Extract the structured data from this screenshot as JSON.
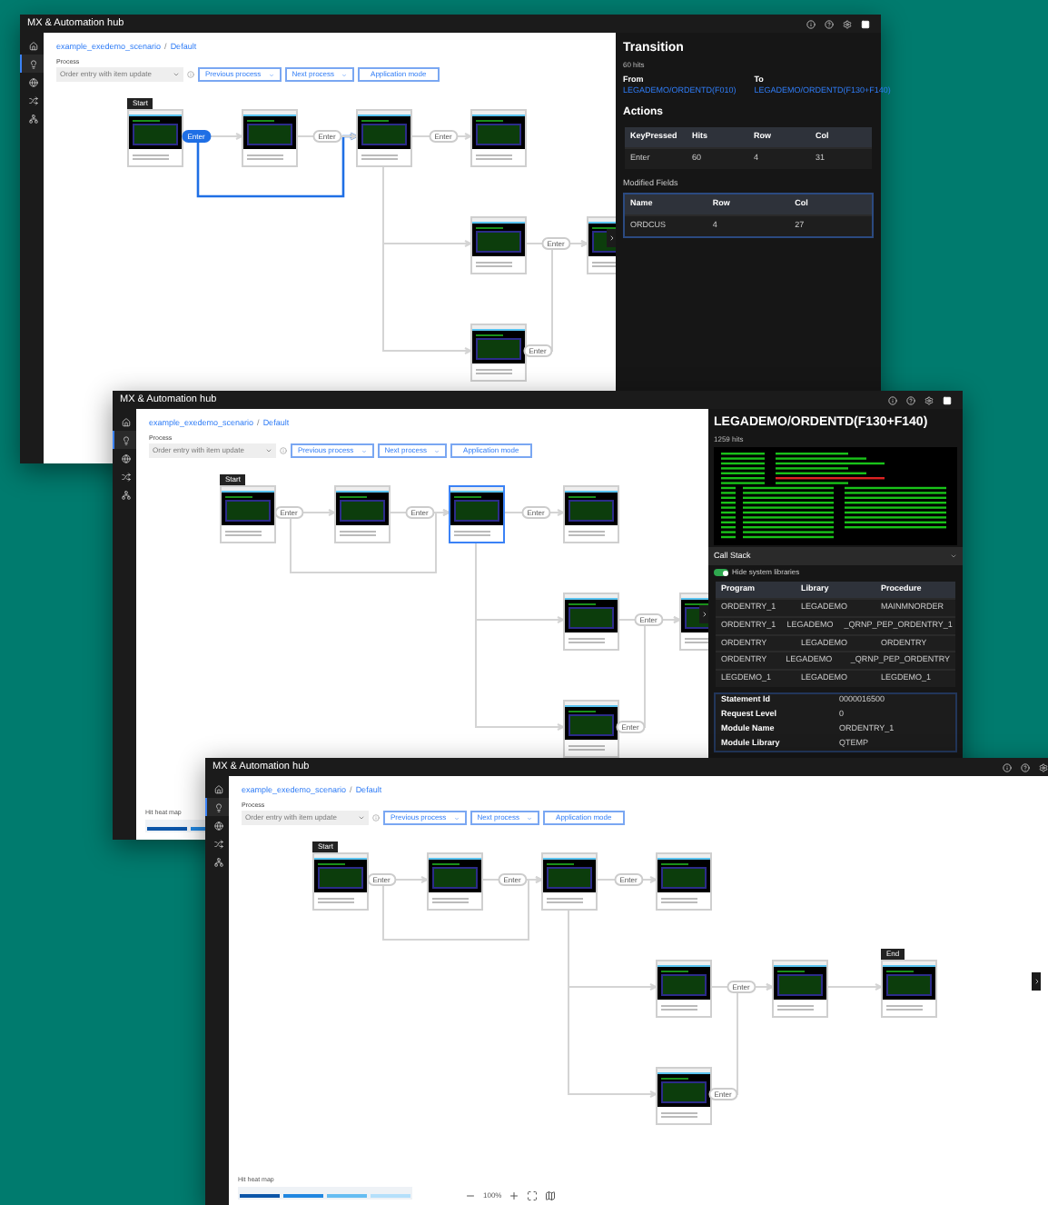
{
  "windows": [
    {
      "title": "MX & Automation hub",
      "breadcrumb": {
        "scenario": "example_exedemo_scenario",
        "separator": "/",
        "view": "Default"
      },
      "process_label": "Process",
      "process_select": "Order entry with item update",
      "buttons": [
        {
          "label": "Previous process",
          "kind": "dropdown"
        },
        {
          "label": "Next process",
          "kind": "dropdown"
        },
        {
          "label": "Application mode",
          "kind": "plain"
        }
      ],
      "sidebar": [
        {
          "selected": false
        },
        {
          "selected": true
        },
        {
          "selected": false
        },
        {
          "selected": false
        },
        {
          "selected": false
        }
      ],
      "diagram": {
        "nodes": [
          {
            "badge": "Start",
            "selected": false
          },
          {
            "selected": false
          },
          {
            "selected": false
          },
          {
            "selected": false
          },
          {
            "selected": false
          },
          {
            "selected": false
          },
          {
            "selected": false
          }
        ],
        "edges": [
          {
            "selected": false
          },
          {
            "label": "Enter",
            "selected": true
          },
          {
            "label": "Enter",
            "selected": false
          },
          {
            "label": "Enter",
            "selected": false
          },
          {
            "selected": false
          },
          {
            "selected": false
          },
          {
            "label": "Enter",
            "selected": false
          },
          {
            "label": "Enter",
            "selected": false
          }
        ]
      },
      "panel": {
        "kind": "transition",
        "title": "Transition",
        "subtitle": "60 hits",
        "from_label": "From",
        "from": "LEGADEMO/ORDENTD(F010)",
        "to_label": "To",
        "to": "LEGADEMO/ORDENTD(F130+F140)",
        "actions_title": "Actions",
        "actions": {
          "columns": [
            "KeyPressed",
            "Hits",
            "Row",
            "Col"
          ],
          "rows": [
            [
              "Enter",
              "60",
              "4",
              "31"
            ]
          ]
        },
        "fields_title": "Modified Fields",
        "fields": {
          "columns": [
            "Name",
            "Row",
            "Col"
          ],
          "rows": [
            [
              "ORDCUS",
              "4",
              "27"
            ]
          ]
        }
      }
    },
    {
      "title": "MX & Automation hub",
      "breadcrumb": {
        "scenario": "example_exedemo_scenario",
        "separator": "/",
        "view": "Default"
      },
      "process_label": "Process",
      "process_select": "Order entry with item update",
      "buttons": [
        {
          "label": "Previous process",
          "kind": "dropdown"
        },
        {
          "label": "Next process",
          "kind": "dropdown"
        },
        {
          "label": "Application mode",
          "kind": "plain"
        }
      ],
      "sidebar": [
        {
          "selected": false
        },
        {
          "selected": true
        },
        {
          "selected": false
        },
        {
          "selected": false
        },
        {
          "selected": false
        }
      ],
      "diagram": {
        "nodes": [
          {
            "badge": "Start",
            "selected": false
          },
          {
            "selected": false
          },
          {
            "selected": true
          },
          {
            "selected": false
          },
          {
            "selected": false
          },
          {
            "selected": false
          },
          {
            "selected": false
          }
        ],
        "edges": [
          {
            "selected": false
          },
          {
            "label": "Enter",
            "selected": false
          },
          {
            "label": "Enter",
            "selected": false
          },
          {
            "label": "Enter",
            "selected": false
          },
          {
            "selected": false
          },
          {
            "selected": false
          },
          {
            "label": "Enter",
            "selected": false
          },
          {
            "label": "Enter",
            "selected": false
          }
        ]
      },
      "heatmap": {
        "label": "Hit heat map"
      },
      "panel": {
        "kind": "screen",
        "title": "LEGADEMO/ORDENTD(F130+F140)",
        "subtitle": "1259 hits",
        "call_stack": {
          "title": "Call Stack",
          "toggle": {
            "label": "Hide system libraries",
            "on": true
          },
          "columns": [
            "Program",
            "Library",
            "Procedure"
          ],
          "rows": [
            [
              "ORDENTRY_1",
              "LEGADEMO",
              "MAINMNORDER"
            ],
            [
              "ORDENTRY_1",
              "LEGADEMO",
              "_QRNP_PEP_ORDENTRY_1"
            ],
            [
              "ORDENTRY",
              "LEGADEMO",
              "ORDENTRY"
            ],
            [
              "ORDENTRY",
              "LEGADEMO",
              "_QRNP_PEP_ORDENTRY"
            ],
            [
              "LEGDEMO_1",
              "LEGADEMO",
              "LEGDEMO_1"
            ]
          ]
        },
        "details": [
          {
            "label": "Statement Id",
            "value": "0000016500"
          },
          {
            "label": "Request Level",
            "value": "0"
          },
          {
            "label": "Module Name",
            "value": "ORDENTRY_1"
          },
          {
            "label": "Module Library",
            "value": "QTEMP"
          }
        ]
      }
    },
    {
      "title": "MX & Automation hub",
      "breadcrumb": {
        "scenario": "example_exedemo_scenario",
        "separator": "/",
        "view": "Default"
      },
      "process_label": "Process",
      "process_select": "Order entry with item update",
      "buttons": [
        {
          "label": "Previous process",
          "kind": "dropdown"
        },
        {
          "label": "Next process",
          "kind": "dropdown"
        },
        {
          "label": "Application mode",
          "kind": "plain"
        }
      ],
      "sidebar": [
        {
          "selected": false
        },
        {
          "selected": true
        },
        {
          "selected": false
        },
        {
          "selected": false
        },
        {
          "selected": false
        }
      ],
      "diagram": {
        "nodes": [
          {
            "badge": "Start",
            "selected": false
          },
          {
            "selected": false
          },
          {
            "selected": false
          },
          {
            "selected": false
          },
          {
            "selected": false
          },
          {
            "selected": false
          },
          {
            "selected": false
          },
          {
            "badge": "End",
            "selected": false
          }
        ],
        "edges": [
          {
            "selected": false
          },
          {
            "label": "Enter",
            "selected": false
          },
          {
            "label": "Enter",
            "selected": false
          },
          {
            "label": "Enter",
            "selected": false
          },
          {
            "selected": false
          },
          {
            "selected": false
          },
          {
            "label": "Enter",
            "selected": false
          },
          {
            "label": "Enter",
            "selected": false
          },
          {
            "selected": false
          }
        ]
      },
      "heatmap": {
        "label": "Hit heat map"
      },
      "zoom": {
        "value": "100%"
      }
    }
  ]
}
